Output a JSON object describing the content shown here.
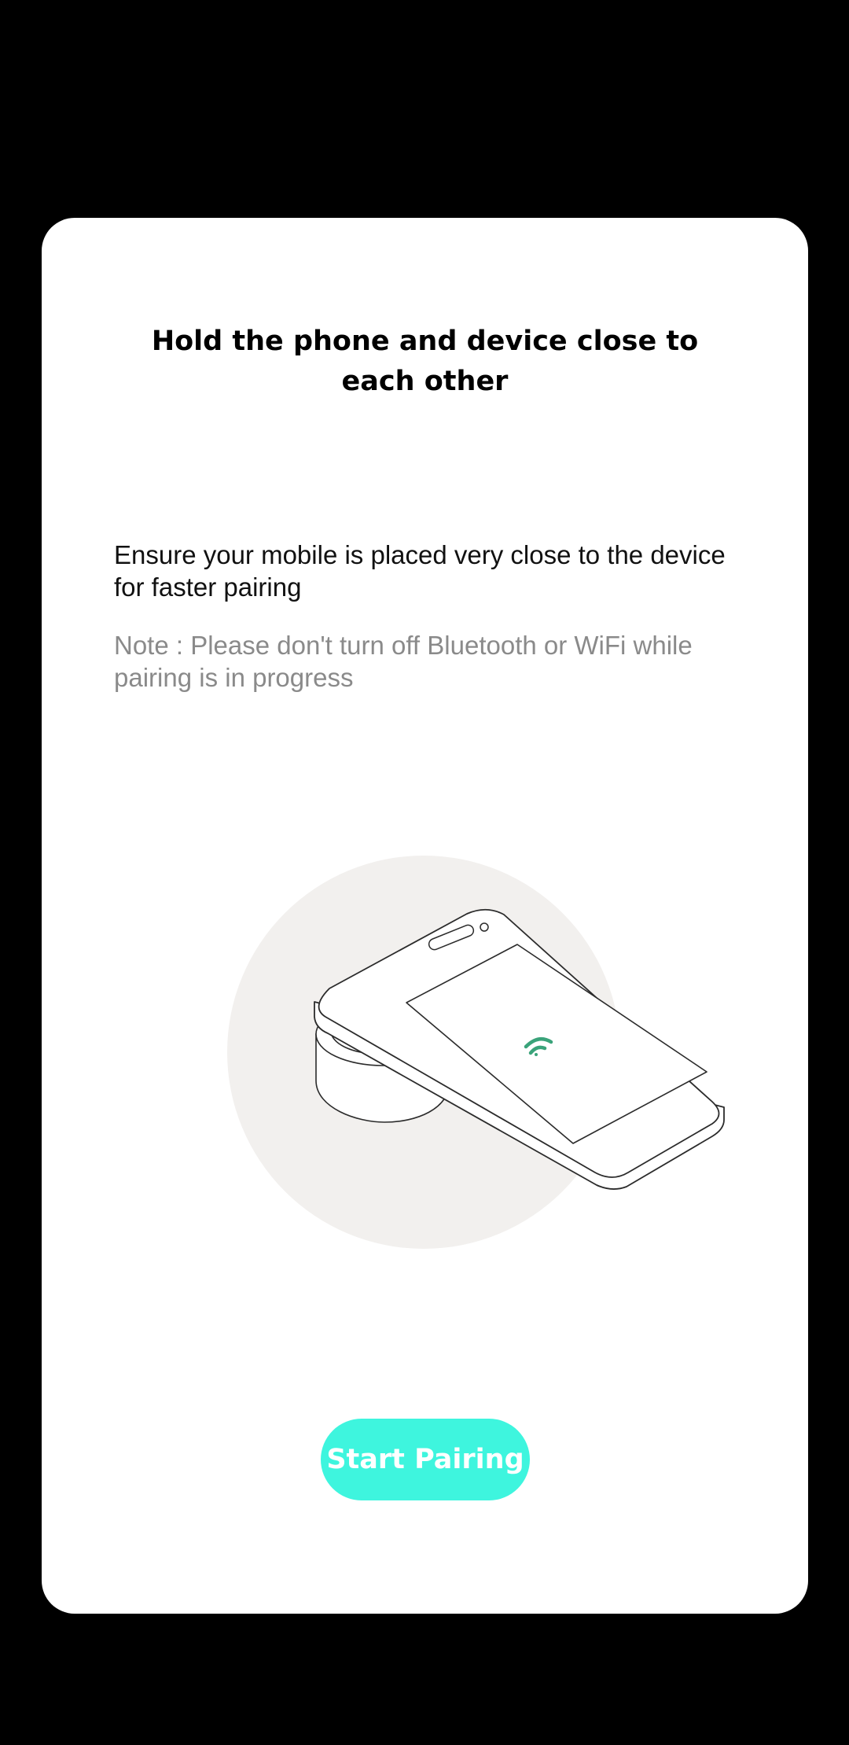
{
  "dialog": {
    "title": "Hold the phone and device close to each other",
    "instruction": "Ensure your mobile is placed very close to the device for faster pairing",
    "note": "Note : Please don't turn off Bluetooth or WiFi while pairing is in progress",
    "start_button_label": "Start Pairing"
  },
  "illustration": {
    "icon": "phone-on-device-pairing-illustration",
    "signal_icon": "wifi-signal-icon"
  },
  "colors": {
    "background": "#000000",
    "card": "#ffffff",
    "accent": "#3ef5de",
    "illustration_circle": "#f2f0ee",
    "signal": "#3aa37a",
    "note_text": "#8a8a8a"
  }
}
